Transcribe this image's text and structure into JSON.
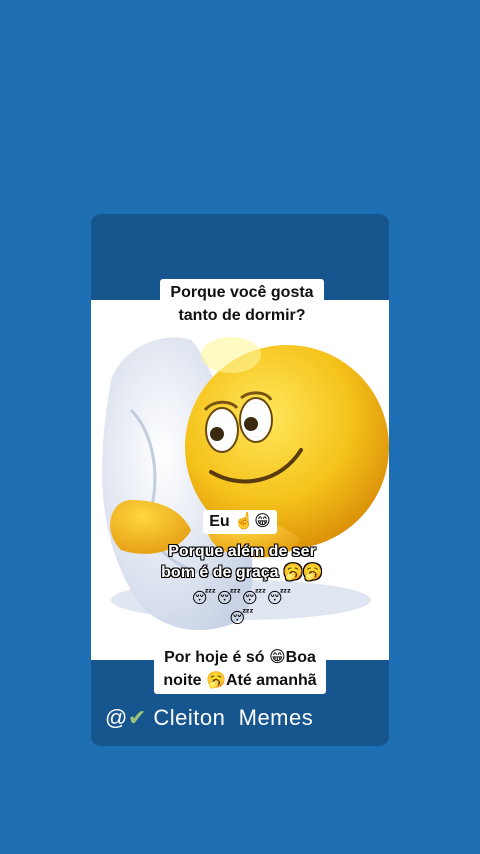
{
  "question": {
    "line1": "Porque você gosta",
    "line2": "tanto de dormir?"
  },
  "answer": {
    "eu_label": "Eu ☝️😁",
    "line1": "Porque além de ser",
    "line2": "bom é de graça 🥱🥱",
    "emoji_row": "😴😴😴😴😴"
  },
  "farewell": {
    "line1": "Por hoje é só 😁Boa",
    "line2": "noite 🥱Até amanhã"
  },
  "credit": {
    "at": "@",
    "check": "✔",
    "name": "Cleiton  Memes"
  }
}
